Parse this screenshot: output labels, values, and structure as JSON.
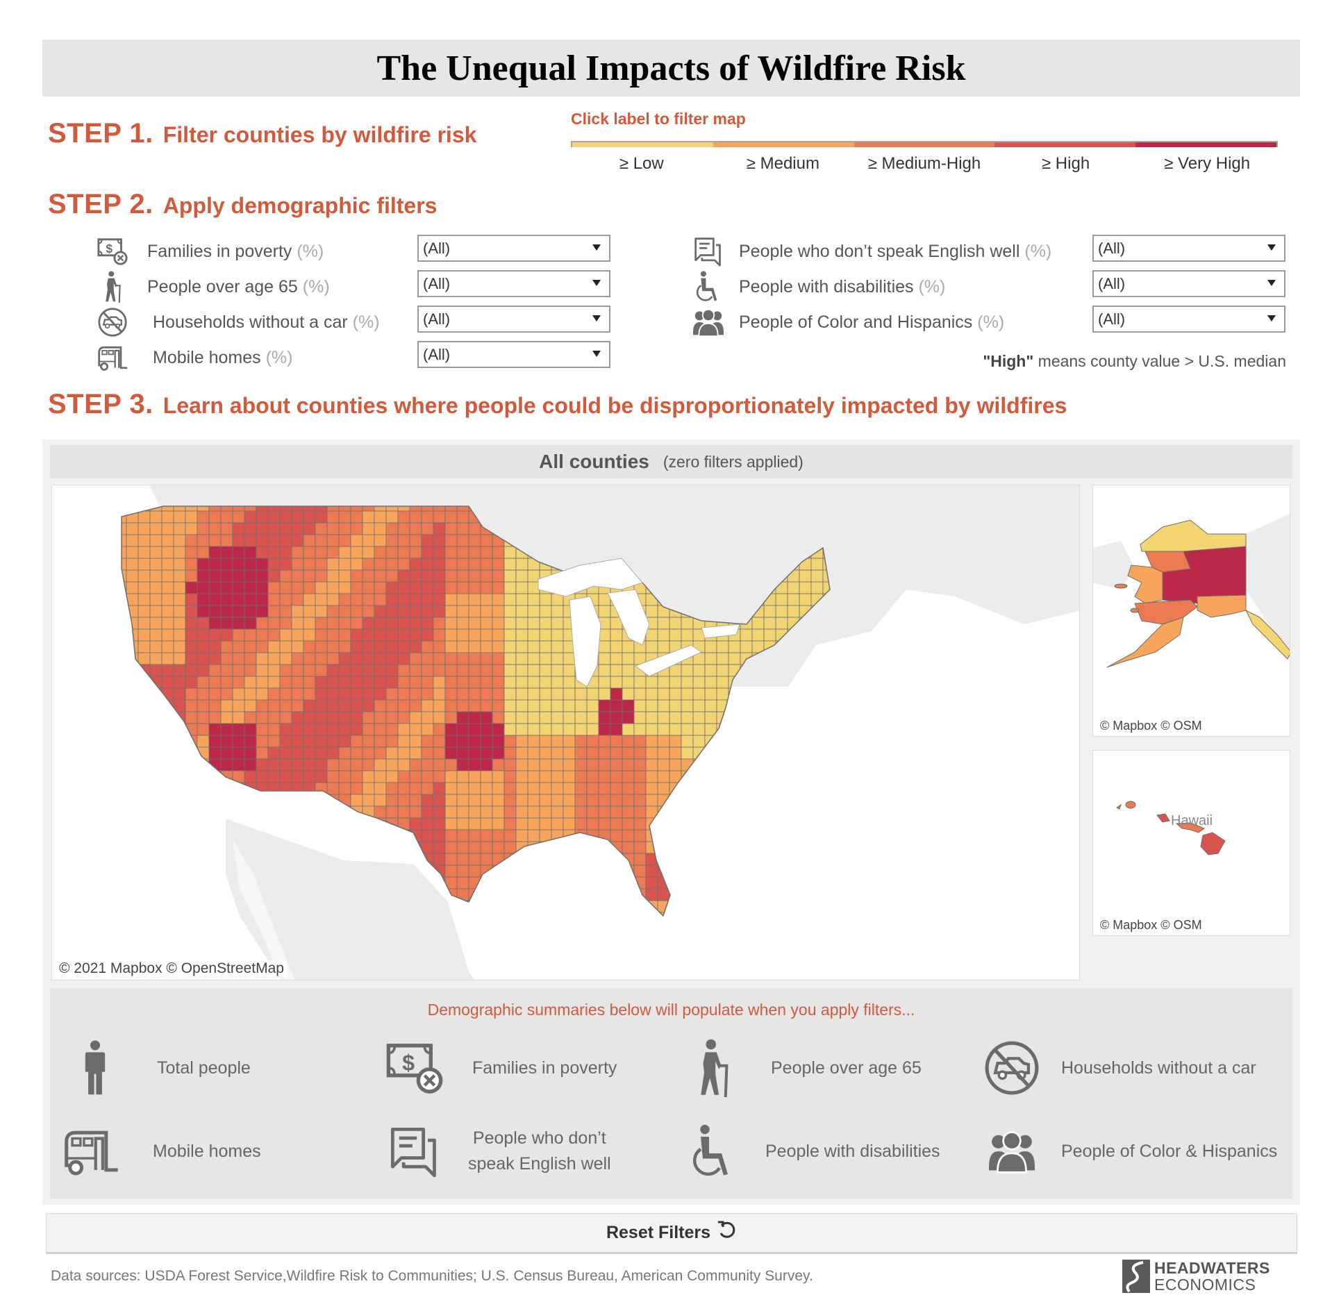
{
  "title": "The Unequal Impacts of Wildfire Risk",
  "step1": {
    "num": "STEP 1.",
    "text": "Filter counties by wildfire risk"
  },
  "step2": {
    "num": "STEP 2.",
    "text": "Apply demographic filters"
  },
  "step3": {
    "num": "STEP 3.",
    "text": "Learn about counties where people could be disproportionately impacted by wildfires"
  },
  "risk_legend": {
    "hint": "Click label to filter map",
    "levels": [
      {
        "label": "≥ Low",
        "color": "#f2d472"
      },
      {
        "label": "≥ Medium",
        "color": "#f6a55a"
      },
      {
        "label": "≥ Medium-High",
        "color": "#ec7a52"
      },
      {
        "label": "≥ High",
        "color": "#d9534f"
      },
      {
        "label": "≥ Very High",
        "color": "#be2848"
      }
    ]
  },
  "filters": {
    "pct_suffix": "(%)",
    "left": [
      {
        "label": "Families in poverty",
        "icon": "money-x-icon",
        "value": "(All)"
      },
      {
        "label": "People over age 65",
        "icon": "elderly-person-icon",
        "value": "(All)"
      },
      {
        "label": "Households without a car",
        "icon": "no-car-icon",
        "value": "(All)"
      },
      {
        "label": "Mobile homes",
        "icon": "mobile-home-icon",
        "value": "(All)"
      }
    ],
    "right": [
      {
        "label": "People who don’t speak English well",
        "icon": "speech-bubbles-icon",
        "value": "(All)"
      },
      {
        "label": "People with disabilities",
        "icon": "wheelchair-icon",
        "value": "(All)"
      },
      {
        "label": "People of Color and Hispanics",
        "icon": "group-people-icon",
        "value": "(All)"
      }
    ],
    "high_note_bold": "\"High\"",
    "high_note_rest": " means county value > U.S. median"
  },
  "map": {
    "header_main": "All counties",
    "header_sub": "(zero filters applied)",
    "main_attribution": "© 2021 Mapbox  © OpenStreetMap",
    "alaska_attribution": "© Mapbox  © OSM",
    "hawaii_attribution": "© Mapbox  © OSM",
    "hawaii_label": "Hawaii",
    "colors": {
      "low": "#f2d472",
      "medium": "#f6a55a",
      "medium_high": "#ec7a52",
      "high": "#d9534f",
      "very_high": "#be2848",
      "land": "#ececec",
      "water": "#ffffff",
      "border": "#6e6e6e"
    }
  },
  "summary": {
    "note": "Demographic summaries below will populate when you apply filters...",
    "items": [
      {
        "label": "Total people",
        "icon": "person-icon"
      },
      {
        "label": "Families in poverty",
        "icon": "money-x-icon"
      },
      {
        "label": "People over age 65",
        "icon": "elderly-person-icon"
      },
      {
        "label": "Households without a car",
        "icon": "no-car-icon"
      },
      {
        "label": "Mobile homes",
        "icon": "mobile-home-icon"
      },
      {
        "label_line1": "People who don’t",
        "label_line2": "speak English well",
        "icon": "speech-bubbles-icon"
      },
      {
        "label": "People with disabilities",
        "icon": "wheelchair-icon"
      },
      {
        "label": "People of Color & Hispanics",
        "icon": "group-people-icon"
      }
    ]
  },
  "reset_label": "Reset Filters",
  "sources": "Data sources: USDA Forest Service,Wildfire Risk to Communities; U.S. Census Bureau, American Community Survey.",
  "logo": {
    "line1": "HEADWATERS",
    "line2": "ECONOMICS"
  }
}
